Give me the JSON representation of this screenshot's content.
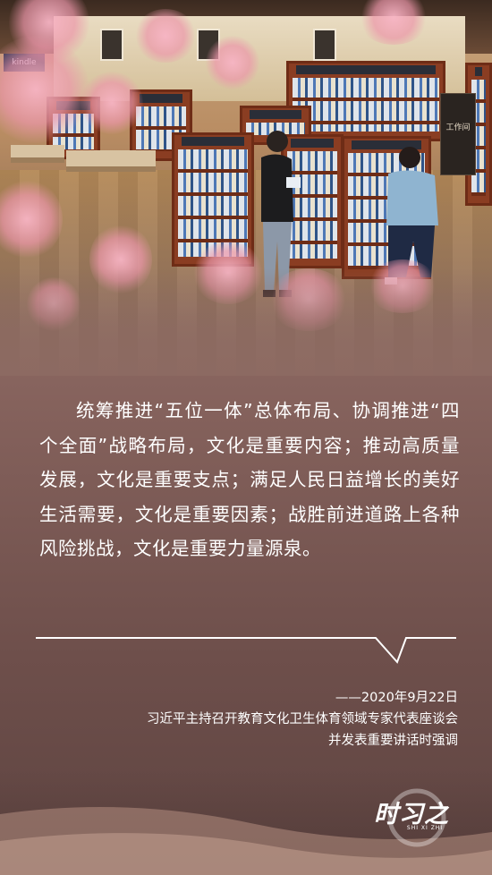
{
  "photo": {
    "sign_left": "kindle",
    "sign_right": "工作间"
  },
  "quote": {
    "text": "统筹推进“五位一体”总体布局、协调推进“四个全面”战略布局，文化是重要内容；推动高质量发展，文化是重要支点；满足人民日益增长的美好生活需要，文化是重要因素；战胜前进道路上各种风险挑战，文化是重要力量源泉。"
  },
  "source": {
    "date": "——2020年9月22日",
    "line1": "习近平主持召开教育文化卫生体育领域专家代表座谈会",
    "line2": "并发表重要讲话时强调"
  },
  "logo": {
    "name": "时习之",
    "sub": "SHI XI ZHI"
  },
  "colors": {
    "background": "#8d6a62",
    "text": "#ffffff",
    "blossom": "#f2a9bb"
  }
}
